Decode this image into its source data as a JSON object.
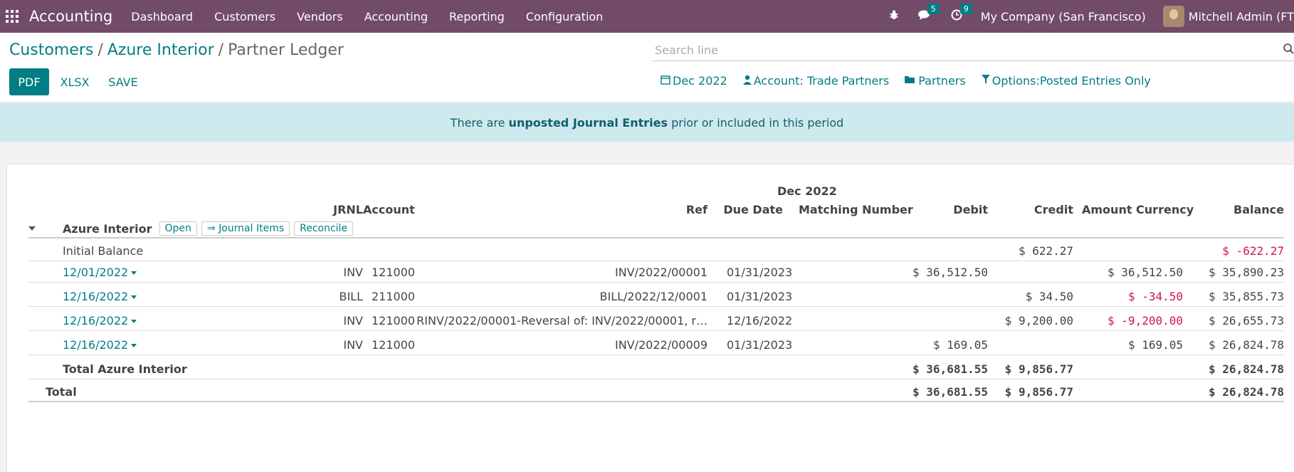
{
  "navbar": {
    "app_title": "Accounting",
    "menu": [
      "Dashboard",
      "Customers",
      "Vendors",
      "Accounting",
      "Reporting",
      "Configuration"
    ],
    "messages_count": "5",
    "activities_count": "9",
    "company": "My Company (San Francisco)",
    "user": "Mitchell Admin (FT"
  },
  "breadcrumb": {
    "items": [
      "Customers",
      "Azure Interior"
    ],
    "current": "Partner Ledger"
  },
  "search": {
    "placeholder": "Search line"
  },
  "buttons": {
    "pdf": "PDF",
    "xlsx": "XLSX",
    "save": "SAVE"
  },
  "filters": {
    "date": "Dec 2022",
    "account": "Account: Trade Partners",
    "partners": "Partners",
    "options": "Options:Posted Entries Only"
  },
  "alert": {
    "prefix": "There are ",
    "bold": "unposted Journal Entries",
    "suffix": " prior or included in this period"
  },
  "report": {
    "period": "Dec 2022",
    "columns": {
      "jrnl": "JRNL",
      "account": "Account",
      "ref": "Ref",
      "due_date": "Due Date",
      "matching": "Matching Number",
      "debit": "Debit",
      "credit": "Credit",
      "amount_currency": "Amount Currency",
      "balance": "Balance"
    },
    "partner": {
      "name": "Azure Interior",
      "chips": [
        "Open",
        "⇒ Journal Items",
        "Reconcile"
      ]
    },
    "initial_balance": {
      "label": "Initial Balance",
      "credit": "$ 622.27",
      "balance": "$ -622.27"
    },
    "lines": [
      {
        "date": "12/01/2022",
        "jrnl": "INV",
        "account": "121000",
        "ref": "INV/2022/00001",
        "due": "01/31/2023",
        "debit": "$ 36,512.50",
        "credit": "",
        "amount_currency": "$ 36,512.50",
        "balance": "$ 35,890.23"
      },
      {
        "date": "12/16/2022",
        "jrnl": "BILL",
        "account": "211000",
        "ref": "BILL/2022/12/0001",
        "due": "01/31/2023",
        "debit": "",
        "credit": "$ 34.50",
        "amount_currency": "$ -34.50",
        "balance": "$ 35,855.73"
      },
      {
        "date": "12/16/2022",
        "jrnl": "INV",
        "account": "121000",
        "ref": "RINV/2022/00001-Reversal of: INV/2022/00001, r…",
        "due": "12/16/2022",
        "debit": "",
        "credit": "$ 9,200.00",
        "amount_currency": "$ -9,200.00",
        "balance": "$ 26,655.73"
      },
      {
        "date": "12/16/2022",
        "jrnl": "INV",
        "account": "121000",
        "ref": "INV/2022/00009",
        "due": "01/31/2023",
        "debit": "$ 169.05",
        "credit": "",
        "amount_currency": "$ 169.05",
        "balance": "$ 26,824.78"
      }
    ],
    "partner_total": {
      "label": "Total Azure Interior",
      "debit": "$ 36,681.55",
      "credit": "$ 9,856.77",
      "balance": "$ 26,824.78"
    },
    "grand_total": {
      "label": "Total",
      "debit": "$ 36,681.55",
      "credit": "$ 9,856.77",
      "balance": "$ 26,824.78"
    }
  },
  "colors": {
    "navbar": "#714b67",
    "accent": "#017e84",
    "negative": "#d0164a",
    "alert_bg": "#cfeaee"
  }
}
